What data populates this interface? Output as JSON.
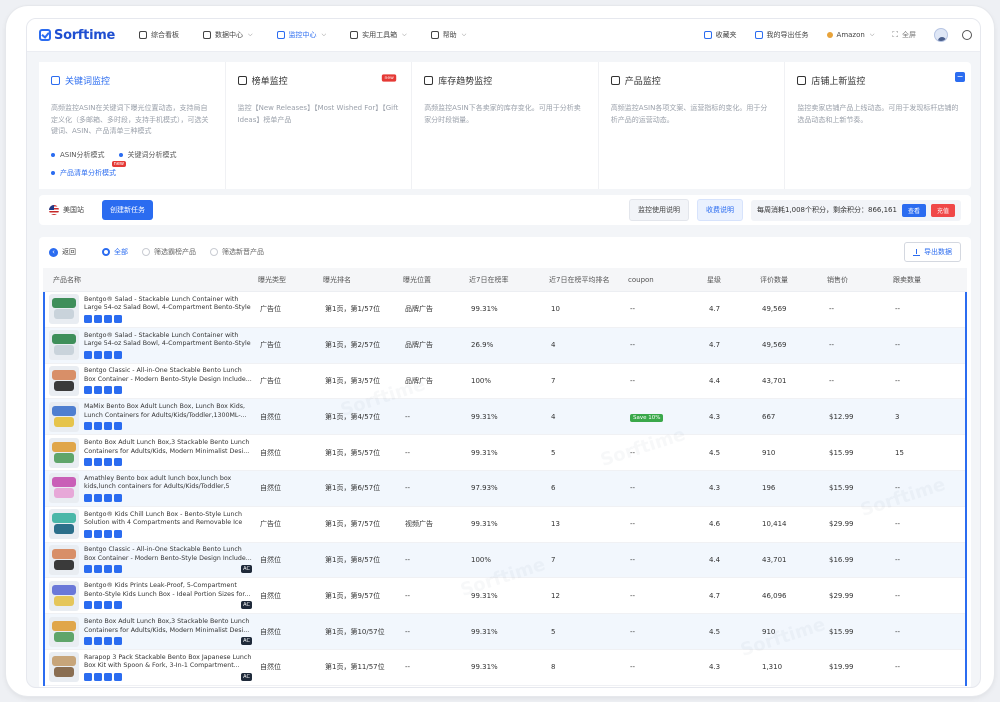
{
  "nav": {
    "logo": "Sorftime",
    "items": [
      {
        "label": "综合看板",
        "caret": false,
        "active": false
      },
      {
        "label": "数据中心",
        "caret": true,
        "active": false
      },
      {
        "label": "监控中心",
        "caret": true,
        "active": true
      },
      {
        "label": "实用工具箱",
        "caret": true,
        "active": false
      },
      {
        "label": "帮助",
        "caret": true,
        "active": false
      }
    ],
    "favorites": "收藏夹",
    "my_export": "我的导出任务",
    "marketplace": "Amazon",
    "fullscreen": "全屏"
  },
  "cards": [
    {
      "title": "关键词监控",
      "desc": "高频监控ASIN在关键词下曝光位置动态，支持局自定义化（多邮箱、多时段，支持手机模式），可选关键词、ASIN、产品清单三种模式",
      "active": true,
      "new": false,
      "modes": [
        {
          "label": "ASIN分析模式",
          "hl": false
        },
        {
          "label": "关键词分析模式",
          "hl": false
        },
        {
          "label": "产品清单分析模式",
          "hl": true,
          "new": "new"
        }
      ]
    },
    {
      "title": "榜单监控",
      "desc": "监控【New Releases】【Most Wished For】【Gift Ideas】榜单产品",
      "active": false,
      "new": "new"
    },
    {
      "title": "库存趋势监控",
      "desc": "高频监控ASIN下各卖家的库存变化。可用于分析卖家分时段销量。",
      "active": false,
      "new": false
    },
    {
      "title": "产品监控",
      "desc": "高频监控ASIN各项文案、运营指标的变化。用于分析产品的运营动态。",
      "active": false,
      "new": false
    },
    {
      "title": "店铺上新监控",
      "desc": "监控卖家店铺产品上线动态。可用于发现标杆店铺的选品动态和上新节奏。",
      "active": false,
      "new": false
    }
  ],
  "taskbar": {
    "site": "美国站",
    "create": "创建新任务",
    "usage_help": "监控使用说明",
    "pricing_help": "收费说明",
    "credit_text": "每周消耗1,008个积分，剩余积分：866,161",
    "view": "查看",
    "recharge": "充值"
  },
  "filter": {
    "back": "返回",
    "radios": [
      {
        "label": "全部",
        "on": true
      },
      {
        "label": "筛选霸榜产品",
        "on": false
      },
      {
        "label": "筛选新晋产品",
        "on": false
      }
    ],
    "export": "导出数据"
  },
  "table": {
    "headers": [
      "产品名称",
      "曝光类型",
      "曝光排名",
      "曝光位置",
      "近7日在榜率",
      "近7日在榜平均排名",
      "coupon",
      "星级",
      "评价数量",
      "销售价",
      "跟卖数量"
    ],
    "rows": [
      {
        "title": "Bentgo® Salad - Stackable Lunch Container with Large 54-oz Salad Bowl, 4-Compartment Bento-Style ...",
        "ac": false,
        "thumb": [
          "#3f8f5a",
          "#c9d3db"
        ],
        "type": "广告位",
        "rank": "第1页，第1/57位",
        "pos": "品牌广告",
        "rate": "99.31%",
        "avg": "10",
        "coupon": "--",
        "star": "4.7",
        "reviews": "49,569",
        "price": "--",
        "sellers": "--"
      },
      {
        "title": "Bentgo® Salad - Stackable Lunch Container with Large 54-oz Salad Bowl, 4-Compartment Bento-Style ...",
        "ac": false,
        "thumb": [
          "#3f8f5a",
          "#c9d3db"
        ],
        "type": "广告位",
        "rank": "第1页，第2/57位",
        "pos": "品牌广告",
        "rate": "26.9%",
        "avg": "4",
        "coupon": "--",
        "star": "4.7",
        "reviews": "49,569",
        "price": "--",
        "sellers": "--"
      },
      {
        "title": "Bentgo Classic - All-in-One Stackable Bento Lunch Box Container - Modern Bento-Style Design Include...",
        "ac": false,
        "thumb": [
          "#d88f68",
          "#3a3a3a"
        ],
        "type": "广告位",
        "rank": "第1页，第3/57位",
        "pos": "品牌广告",
        "rate": "100%",
        "avg": "7",
        "coupon": "--",
        "star": "4.4",
        "reviews": "43,701",
        "price": "--",
        "sellers": "--"
      },
      {
        "title": "MaMix Bento Box Adult Lunch Box, Lunch Box Kids, Lunch Containers for Adults/Kids/Toddler,1300ML-...",
        "ac": false,
        "thumb": [
          "#4f7fd0",
          "#e6c44b"
        ],
        "type": "自然位",
        "rank": "第1页，第4/57位",
        "pos": "--",
        "rate": "99.31%",
        "avg": "4",
        "coupon": "Save 10%",
        "star": "4.3",
        "reviews": "667",
        "price": "$12.99",
        "sellers": "3"
      },
      {
        "title": "Bento Box Adult Lunch Box,3 Stackable Bento Lunch Containers for Adults/Kids, Modern Minimalist Desi...",
        "ac": false,
        "thumb": [
          "#e0a64a",
          "#5fa56a"
        ],
        "type": "自然位",
        "rank": "第1页，第5/57位",
        "pos": "--",
        "rate": "99.31%",
        "avg": "5",
        "coupon": "--",
        "star": "4.5",
        "reviews": "910",
        "price": "$15.99",
        "sellers": "15"
      },
      {
        "title": "Amathley Bento box adult lunch box,lunch box kids,lunch containers for Adults/Kids/Toddler,5 Compartm...",
        "ac": false,
        "thumb": [
          "#c95fb7",
          "#e7a8d8"
        ],
        "type": "自然位",
        "rank": "第1页，第6/57位",
        "pos": "--",
        "rate": "97.93%",
        "avg": "6",
        "coupon": "--",
        "star": "4.3",
        "reviews": "196",
        "price": "$15.99",
        "sellers": "--"
      },
      {
        "title": "Bentgo® Kids Chill Lunch Box - Bento-Style Lunch Solution with 4 Compartments and Removable Ice P...",
        "ac": false,
        "thumb": [
          "#4ab7a8",
          "#2c6f8a"
        ],
        "type": "广告位",
        "rank": "第1页，第7/57位",
        "pos": "视频广告",
        "rate": "99.31%",
        "avg": "13",
        "coupon": "--",
        "star": "4.6",
        "reviews": "10,414",
        "price": "$29.99",
        "sellers": "--"
      },
      {
        "title": "Bentgo Classic - All-in-One Stackable Bento Lunch Box Container - Modern Bento-Style Design Include...",
        "ac": true,
        "thumb": [
          "#d88f68",
          "#3a3a3a"
        ],
        "type": "自然位",
        "rank": "第1页，第8/57位",
        "pos": "--",
        "rate": "100%",
        "avg": "7",
        "coupon": "--",
        "star": "4.4",
        "reviews": "43,701",
        "price": "$16.99",
        "sellers": "--"
      },
      {
        "title": "Bentgo® Kids Prints Leak-Proof, 5-Compartment Bento-Style Kids Lunch Box - Ideal Portion Sizes for...",
        "ac": true,
        "thumb": [
          "#6a78d8",
          "#e5c65a"
        ],
        "type": "自然位",
        "rank": "第1页，第9/57位",
        "pos": "--",
        "rate": "99.31%",
        "avg": "12",
        "coupon": "--",
        "star": "4.7",
        "reviews": "46,096",
        "price": "$29.99",
        "sellers": "--"
      },
      {
        "title": "Bento Box Adult Lunch Box,3 Stackable Bento Lunch Containers for Adults/Kids, Modern Minimalist Desi...",
        "ac": true,
        "thumb": [
          "#e0a64a",
          "#5fa56a"
        ],
        "type": "自然位",
        "rank": "第1页，第10/57位",
        "pos": "--",
        "rate": "99.31%",
        "avg": "5",
        "coupon": "--",
        "star": "4.5",
        "reviews": "910",
        "price": "$15.99",
        "sellers": "--"
      },
      {
        "title": "Rarapop 3 Pack Stackable Bento Box Japanese Lunch Box Kit with Spoon & Fork, 3-In-1 Compartment...",
        "ac": true,
        "thumb": [
          "#c7a57a",
          "#8a6e52"
        ],
        "type": "自然位",
        "rank": "第1页，第11/57位",
        "pos": "--",
        "rate": "99.31%",
        "avg": "8",
        "coupon": "--",
        "star": "4.3",
        "reviews": "1,310",
        "price": "$19.99",
        "sellers": "--"
      }
    ]
  }
}
